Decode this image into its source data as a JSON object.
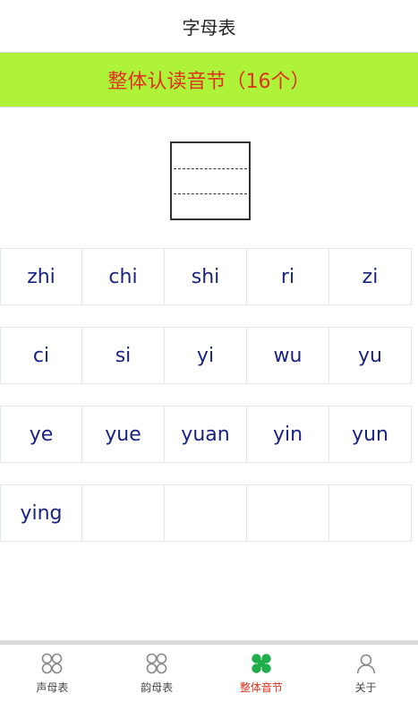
{
  "header": {
    "title": "字母表"
  },
  "banner": {
    "text": "整体认读音节（16个）"
  },
  "syllables": {
    "row1": [
      "zhi",
      "chi",
      "shi",
      "ri",
      "zi"
    ],
    "row2": [
      "ci",
      "si",
      "yi",
      "wu",
      "yu"
    ],
    "row3": [
      "ye",
      "yue",
      "yuan",
      "yin",
      "yun"
    ],
    "row4": [
      "ying",
      "",
      "",
      "",
      ""
    ]
  },
  "tabs": [
    {
      "label": "声母表",
      "icon": "grid-four-circles-icon"
    },
    {
      "label": "韵母表",
      "icon": "grid-four-circles-icon"
    },
    {
      "label": "整体音节",
      "icon": "grid-four-filled-icon",
      "active": true
    },
    {
      "label": "关于",
      "icon": "person-icon"
    }
  ],
  "colors": {
    "banner_bg": "#aef23a",
    "banner_text": "#e0311f",
    "syllable_text": "#1a237e",
    "active_tab": "#1fae4b",
    "inactive_icon": "#888888"
  }
}
